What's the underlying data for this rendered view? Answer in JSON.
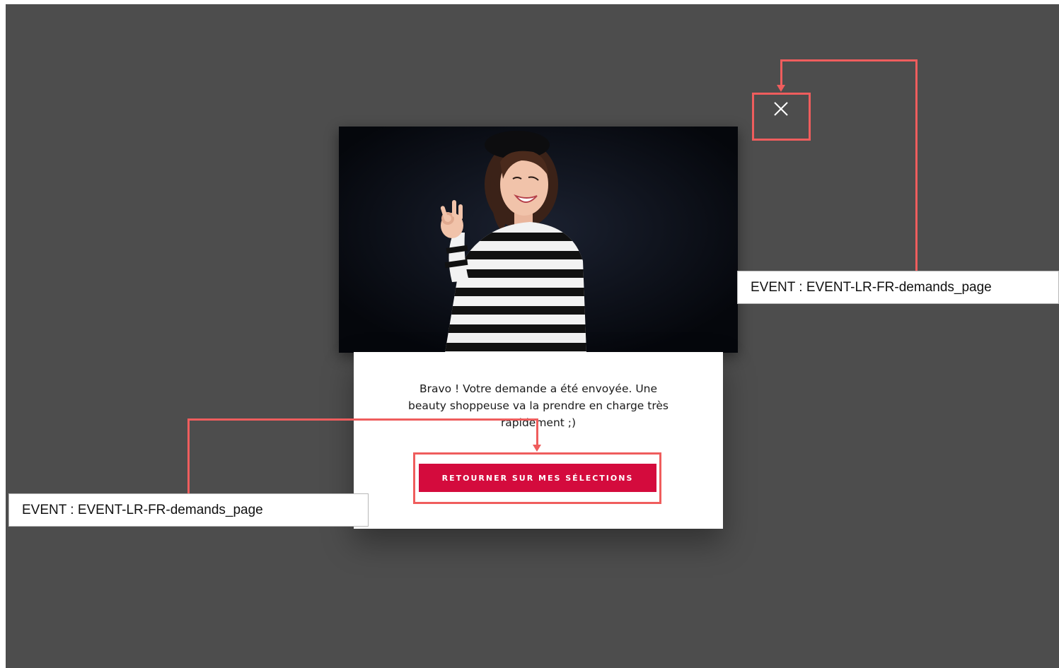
{
  "modal": {
    "message": "Bravo ! Votre demande a été envoyée. Une beauty shoppeuse va la prendre en charge très rapidement ;)",
    "cta_label": "RETOURNER SUR MES SÉLECTIONS",
    "close_icon": "close-icon",
    "hero_image": "woman-in-striped-sweater-ok-gesture"
  },
  "annotations": {
    "close_event": "EVENT : EVENT-LR-FR-demands_page",
    "cta_event": "EVENT : EVENT-LR-FR-demands_page"
  },
  "colors": {
    "overlay": "#4d4d4d",
    "accent": "#d40b3d",
    "annotation": "#ef5d5d"
  }
}
